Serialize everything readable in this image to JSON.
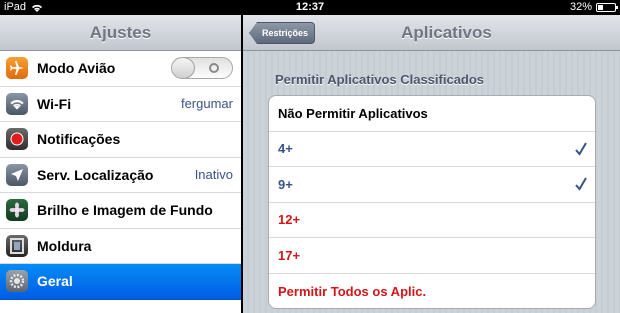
{
  "status_bar": {
    "device": "iPad",
    "time": "12:37",
    "battery": "32%",
    "battery_level": 0.32
  },
  "left_pane": {
    "title": "Ajustes",
    "items": [
      {
        "label": "Modo Avião",
        "icon": "airplane-icon",
        "toggle": "off"
      },
      {
        "label": "Wi-Fi",
        "value": "fergumar",
        "icon": "wifi-icon"
      },
      {
        "label": "Notificações",
        "icon": "notifications-icon"
      },
      {
        "label": "Serv. Localização",
        "value": "Inativo",
        "icon": "location-icon"
      },
      {
        "label": "Brilho e Imagem de Fundo",
        "icon": "brightness-wallpaper-icon"
      },
      {
        "label": "Moldura",
        "icon": "picture-frame-icon"
      },
      {
        "label": "Geral",
        "icon": "general-gear-icon",
        "selected": true
      }
    ]
  },
  "right_pane": {
    "back_button": "Restrições",
    "title": "Aplicativos",
    "section_header": "Permitir Aplicativos Classificados",
    "options": [
      {
        "label": "Não Permitir Aplicativos",
        "style": "black",
        "checked": false
      },
      {
        "label": "4+",
        "style": "blue",
        "checked": true
      },
      {
        "label": "9+",
        "style": "blue",
        "checked": true
      },
      {
        "label": "12+",
        "style": "red",
        "checked": false
      },
      {
        "label": "17+",
        "style": "red",
        "checked": false
      },
      {
        "label": "Permitir Todos os Aplic.",
        "style": "red",
        "checked": false
      }
    ]
  },
  "colors": {
    "selection": "#015de6",
    "value_text": "#385487",
    "red_text": "#d61518"
  }
}
